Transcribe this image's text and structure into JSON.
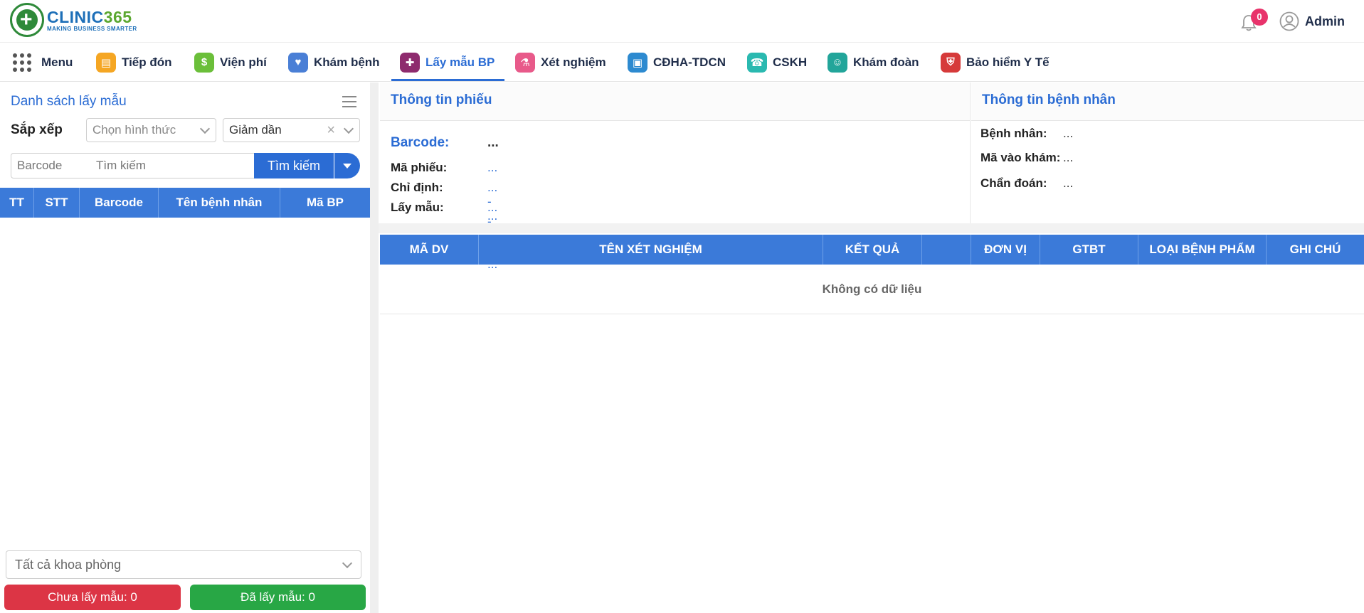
{
  "brand": {
    "name_a": "CLINIC",
    "name_b": "365",
    "tagline": "MAKING BUSINESS SMARTER"
  },
  "header": {
    "notification_count": "0",
    "user_name": "Admin"
  },
  "nav": {
    "menu_label": "Menu",
    "items": [
      {
        "label": "Tiếp đón",
        "icon": "reception-icon",
        "color": "#f5a623"
      },
      {
        "label": "Viện phí",
        "icon": "bill-icon",
        "color": "#6bbf3a"
      },
      {
        "label": "Khám bệnh",
        "icon": "stethoscope-icon",
        "color": "#4a7fd6"
      },
      {
        "label": "Lấy mẫu BP",
        "icon": "sample-icon",
        "color": "#8e2b6e",
        "active": true
      },
      {
        "label": "Xét nghiệm",
        "icon": "lab-icon",
        "color": "#e85a8a"
      },
      {
        "label": "CĐHA-TDCN",
        "icon": "imaging-icon",
        "color": "#2d8ad0"
      },
      {
        "label": "CSKH",
        "icon": "phone-icon",
        "color": "#2ab9b0"
      },
      {
        "label": "Khám đoàn",
        "icon": "group-icon",
        "color": "#22a59a"
      },
      {
        "label": "Bảo hiểm Y Tế",
        "icon": "shield-icon",
        "color": "#d63a3a"
      }
    ]
  },
  "left": {
    "title": "Danh sách lấy mẫu",
    "sort_label": "Sắp xếp",
    "sort_method_placeholder": "Chọn hình thức",
    "sort_order_value": "Giảm dần",
    "barcode_placeholder": "Barcode",
    "search_placeholder": "Tìm kiếm",
    "search_button": "Tìm kiếm",
    "table_headers": [
      "TT",
      "STT",
      "Barcode",
      "Tên bệnh nhân",
      "Mã BP"
    ],
    "department_placeholder": "Tất cả khoa phòng",
    "pending_label": "Chưa lấy mẫu: 0",
    "done_label": "Đã lấy mẫu: 0"
  },
  "ticket": {
    "title": "Thông tin phiếu",
    "barcode_label": "Barcode:",
    "barcode_value": "...",
    "code_label": "Mã phiếu:",
    "code_value": "...",
    "order_label": "Chỉ định:",
    "order_value": "... - ... - ...",
    "sample_label": "Lấy mẫu:",
    "sample_value": "... - ... - ..."
  },
  "patient": {
    "title": "Thông tin bệnh nhân",
    "name_label": "Bệnh nhân:",
    "name_value": "...",
    "visit_label": "Mã vào khám:",
    "visit_value": "...",
    "diag_label": "Chẩn đoán:",
    "diag_value": "..."
  },
  "results": {
    "headers": [
      "MÃ DV",
      "TÊN XÉT NGHIỆM",
      "KẾT QUẢ",
      "",
      "ĐƠN VỊ",
      "GTBT",
      "LOẠI BỆNH PHẨM",
      "GHI CHÚ"
    ],
    "empty_text": "Không có dữ liệu"
  },
  "colors": {
    "primary": "#2b6cd4",
    "table_header": "#3b7ad9",
    "danger": "#dc3545",
    "success": "#28a745",
    "badge": "#e8336b"
  }
}
